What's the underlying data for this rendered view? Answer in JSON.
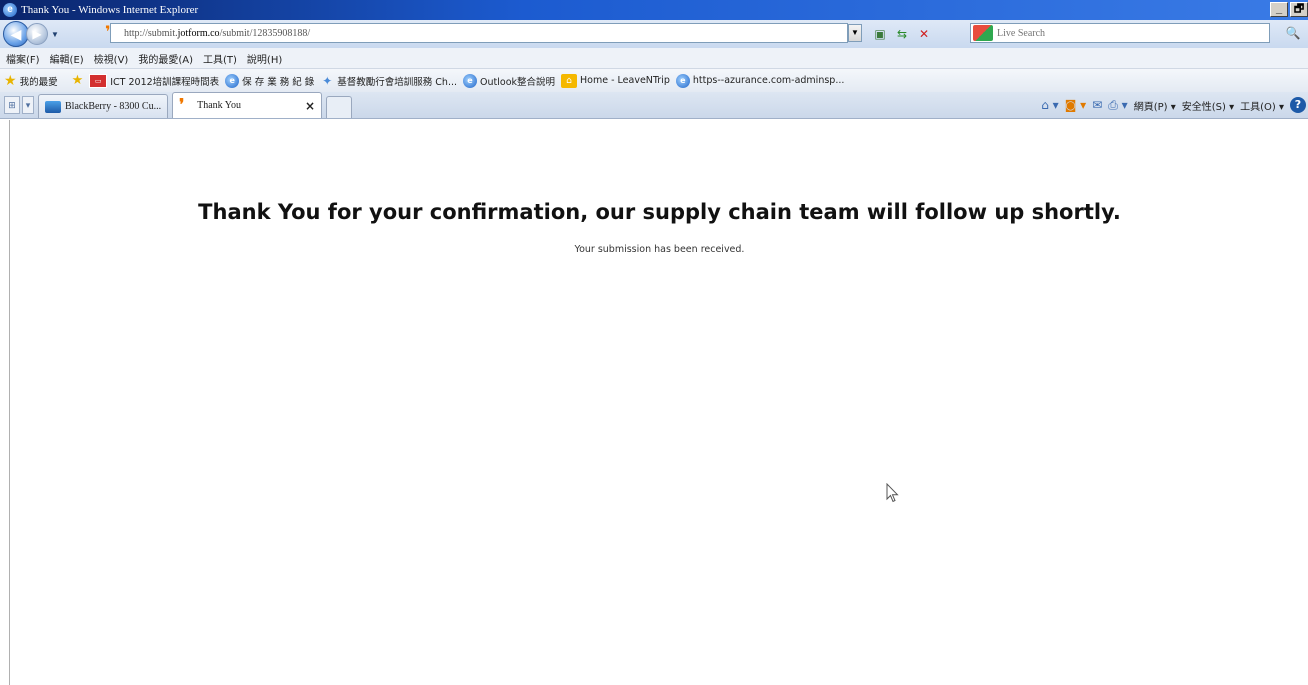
{
  "window": {
    "title": "Thank You - Windows Internet Explorer",
    "controls": [
      "_",
      "🗗"
    ]
  },
  "address_bar": {
    "url_prefix": "http://submit.",
    "url_domain": "jotform.co",
    "url_suffix": "/submit/12835908188/",
    "search_placeholder": "Live Search"
  },
  "menu": {
    "items": [
      "檔案(F)",
      "編輯(E)",
      "檢視(V)",
      "我的最愛(A)",
      "工具(T)",
      "說明(H)"
    ]
  },
  "favorites": {
    "label": "我的最愛",
    "items": [
      {
        "label": "ICT 2012培訓課程時間表"
      },
      {
        "label": "保 存 業 務 紀 錄"
      },
      {
        "label": "基督教勵行會培訓服務 Ch..."
      },
      {
        "label": "Outlook整合說明"
      },
      {
        "label": "Home - LeaveNTrip"
      },
      {
        "label": "https--azurance.com-adminsp..."
      }
    ]
  },
  "tabs": [
    {
      "label": "BlackBerry - 8300 Cu..."
    },
    {
      "label": "Thank You",
      "close": "×"
    }
  ],
  "command_bar": {
    "page": "網頁(P)",
    "safety": "安全性(S)",
    "tools": "工具(O)"
  },
  "page": {
    "heading": "Thank You for your confirmation, our supply chain team will follow up shortly.",
    "subtext": "Your submission has been received."
  }
}
